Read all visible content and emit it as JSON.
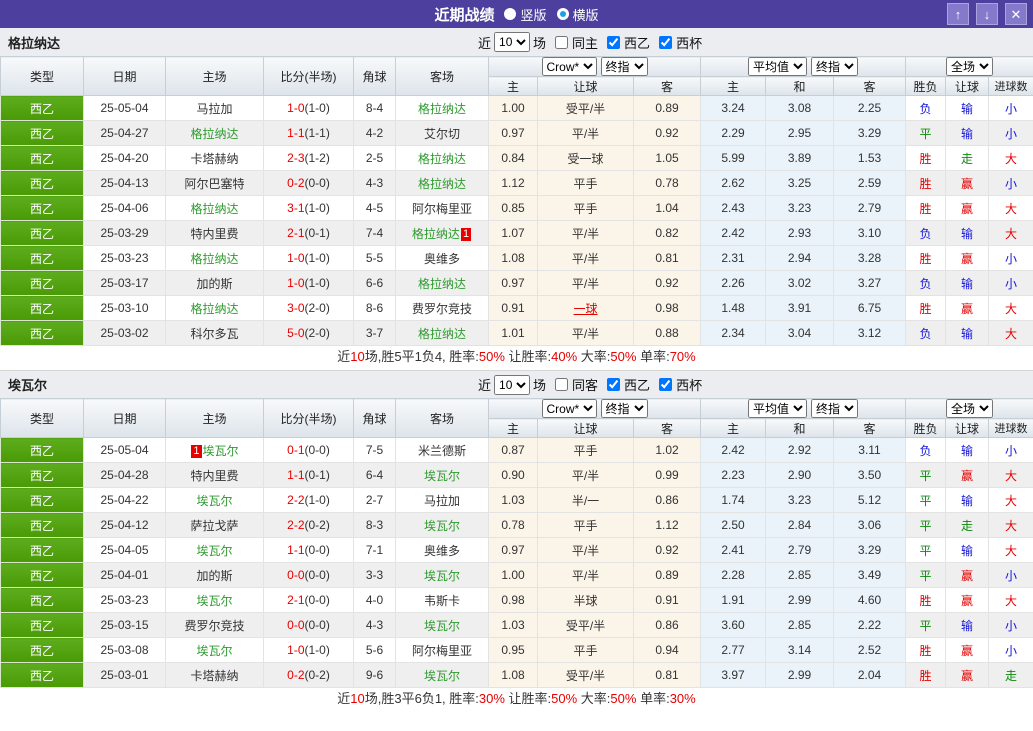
{
  "titlebar": {
    "title": "近期战绩",
    "radios": [
      {
        "label": "竖版",
        "selected": false
      },
      {
        "label": "横版",
        "selected": true
      }
    ],
    "buttons": {
      "up": "↑",
      "down": "↓",
      "close": "✕"
    }
  },
  "colors": {
    "titlebar_bg": "#4c3f9d",
    "titlebar_button_bg": "#837acb",
    "league_cell_green": "#4a9a06",
    "team_highlight_green": "#2e9b2e",
    "score_red": "#e60000",
    "win_red": "#e60000",
    "draw_green": "#0b8a0b",
    "lose_blue": "#1414d8",
    "crow_col_bg": "#fbf4e8",
    "avg_col_bg": "#e9f3f9"
  },
  "table_header": {
    "cols": [
      "类型",
      "日期",
      "主场",
      "比分(半场)",
      "角球",
      "客场"
    ],
    "sub": [
      "主",
      "让球",
      "客",
      "主",
      "和",
      "客",
      "胜负",
      "让球",
      "进球数"
    ],
    "selects": {
      "company": "Crow*",
      "final1": "终指",
      "average": "平均值",
      "final2": "终指",
      "scope": "全场"
    }
  },
  "sections": [
    {
      "team": "格拉纳达",
      "filter": {
        "prefix": "近",
        "count": "10",
        "suffix": "场",
        "same_label": "同主",
        "same_checked": false,
        "league_label": "西乙",
        "league_checked": true,
        "cup_label": "西杯",
        "cup_checked": true
      },
      "rows": [
        {
          "league": "西乙",
          "date": "25-05-04",
          "home": "马拉加",
          "home_hl": false,
          "home_badge": "",
          "home_badge_pos": "",
          "score": "1-0",
          "half": "(1-0)",
          "corner": "8-4",
          "away": "格拉纳达",
          "away_hl": true,
          "away_badge": "",
          "away_badge_pos": "",
          "crow_h": "1.00",
          "line": "受平/半",
          "line_changed": false,
          "crow_a": "0.89",
          "avg_h": "3.24",
          "avg_d": "3.08",
          "avg_a": "2.25",
          "result": "负",
          "asian": "输",
          "goals": "小"
        },
        {
          "league": "西乙",
          "date": "25-04-27",
          "home": "格拉纳达",
          "home_hl": true,
          "home_badge": "",
          "home_badge_pos": "",
          "score": "1-1",
          "half": "(1-1)",
          "corner": "4-2",
          "away": "艾尔切",
          "away_hl": false,
          "away_badge": "",
          "away_badge_pos": "",
          "crow_h": "0.97",
          "line": "平/半",
          "line_changed": false,
          "crow_a": "0.92",
          "avg_h": "2.29",
          "avg_d": "2.95",
          "avg_a": "3.29",
          "result": "平",
          "asian": "输",
          "goals": "小"
        },
        {
          "league": "西乙",
          "date": "25-04-20",
          "home": "卡塔赫纳",
          "home_hl": false,
          "home_badge": "",
          "home_badge_pos": "",
          "score": "2-3",
          "half": "(1-2)",
          "corner": "2-5",
          "away": "格拉纳达",
          "away_hl": true,
          "away_badge": "",
          "away_badge_pos": "",
          "crow_h": "0.84",
          "line": "受一球",
          "line_changed": false,
          "crow_a": "1.05",
          "avg_h": "5.99",
          "avg_d": "3.89",
          "avg_a": "1.53",
          "result": "胜",
          "asian": "走",
          "goals": "大"
        },
        {
          "league": "西乙",
          "date": "25-04-13",
          "home": "阿尔巴塞特",
          "home_hl": false,
          "home_badge": "",
          "home_badge_pos": "",
          "score": "0-2",
          "half": "(0-0)",
          "corner": "4-3",
          "away": "格拉纳达",
          "away_hl": true,
          "away_badge": "",
          "away_badge_pos": "",
          "crow_h": "1.12",
          "line": "平手",
          "line_changed": false,
          "crow_a": "0.78",
          "avg_h": "2.62",
          "avg_d": "3.25",
          "avg_a": "2.59",
          "result": "胜",
          "asian": "赢",
          "goals": "小"
        },
        {
          "league": "西乙",
          "date": "25-04-06",
          "home": "格拉纳达",
          "home_hl": true,
          "home_badge": "",
          "home_badge_pos": "",
          "score": "3-1",
          "half": "(1-0)",
          "corner": "4-5",
          "away": "阿尔梅里亚",
          "away_hl": false,
          "away_badge": "",
          "away_badge_pos": "",
          "crow_h": "0.85",
          "line": "平手",
          "line_changed": false,
          "crow_a": "1.04",
          "avg_h": "2.43",
          "avg_d": "3.23",
          "avg_a": "2.79",
          "result": "胜",
          "asian": "赢",
          "goals": "大"
        },
        {
          "league": "西乙",
          "date": "25-03-29",
          "home": "特内里费",
          "home_hl": false,
          "home_badge": "",
          "home_badge_pos": "",
          "score": "2-1",
          "half": "(0-1)",
          "corner": "7-4",
          "away": "格拉纳达",
          "away_hl": true,
          "away_badge": "1",
          "away_badge_pos": "after",
          "crow_h": "1.07",
          "line": "平/半",
          "line_changed": false,
          "crow_a": "0.82",
          "avg_h": "2.42",
          "avg_d": "2.93",
          "avg_a": "3.10",
          "result": "负",
          "asian": "输",
          "goals": "大"
        },
        {
          "league": "西乙",
          "date": "25-03-23",
          "home": "格拉纳达",
          "home_hl": true,
          "home_badge": "",
          "home_badge_pos": "",
          "score": "1-0",
          "half": "(1-0)",
          "corner": "5-5",
          "away": "奥维多",
          "away_hl": false,
          "away_badge": "",
          "away_badge_pos": "",
          "crow_h": "1.08",
          "line": "平/半",
          "line_changed": false,
          "crow_a": "0.81",
          "avg_h": "2.31",
          "avg_d": "2.94",
          "avg_a": "3.28",
          "result": "胜",
          "asian": "赢",
          "goals": "小"
        },
        {
          "league": "西乙",
          "date": "25-03-17",
          "home": "加的斯",
          "home_hl": false,
          "home_badge": "",
          "home_badge_pos": "",
          "score": "1-0",
          "half": "(1-0)",
          "corner": "6-6",
          "away": "格拉纳达",
          "away_hl": true,
          "away_badge": "",
          "away_badge_pos": "",
          "crow_h": "0.97",
          "line": "平/半",
          "line_changed": false,
          "crow_a": "0.92",
          "avg_h": "2.26",
          "avg_d": "3.02",
          "avg_a": "3.27",
          "result": "负",
          "asian": "输",
          "goals": "小"
        },
        {
          "league": "西乙",
          "date": "25-03-10",
          "home": "格拉纳达",
          "home_hl": true,
          "home_badge": "",
          "home_badge_pos": "",
          "score": "3-0",
          "half": "(2-0)",
          "corner": "8-6",
          "away": "费罗尔竞技",
          "away_hl": false,
          "away_badge": "",
          "away_badge_pos": "",
          "crow_h": "0.91",
          "line": "一球",
          "line_changed": true,
          "crow_a": "0.98",
          "avg_h": "1.48",
          "avg_d": "3.91",
          "avg_a": "6.75",
          "result": "胜",
          "asian": "赢",
          "goals": "大"
        },
        {
          "league": "西乙",
          "date": "25-03-02",
          "home": "科尔多瓦",
          "home_hl": false,
          "home_badge": "",
          "home_badge_pos": "",
          "score": "5-0",
          "half": "(2-0)",
          "corner": "3-7",
          "away": "格拉纳达",
          "away_hl": true,
          "away_badge": "",
          "away_badge_pos": "",
          "crow_h": "1.01",
          "line": "平/半",
          "line_changed": false,
          "crow_a": "0.88",
          "avg_h": "2.34",
          "avg_d": "3.04",
          "avg_a": "3.12",
          "result": "负",
          "asian": "输",
          "goals": "大"
        }
      ],
      "summary": [
        {
          "t": "近",
          "red": false
        },
        {
          "t": "10",
          "red": true
        },
        {
          "t": "场,胜5平1负4, 胜率:",
          "red": false
        },
        {
          "t": "50%",
          "red": true
        },
        {
          "t": " 让胜率:",
          "red": false
        },
        {
          "t": "40%",
          "red": true
        },
        {
          "t": " 大率:",
          "red": false
        },
        {
          "t": "50%",
          "red": true
        },
        {
          "t": " 单率:",
          "red": false
        },
        {
          "t": "70%",
          "red": true
        }
      ]
    },
    {
      "team": "埃瓦尔",
      "filter": {
        "prefix": "近",
        "count": "10",
        "suffix": "场",
        "same_label": "同客",
        "same_checked": false,
        "league_label": "西乙",
        "league_checked": true,
        "cup_label": "西杯",
        "cup_checked": true
      },
      "rows": [
        {
          "league": "西乙",
          "date": "25-05-04",
          "home": "埃瓦尔",
          "home_hl": true,
          "home_badge": "1",
          "home_badge_pos": "before",
          "score": "0-1",
          "half": "(0-0)",
          "corner": "7-5",
          "away": "米兰德斯",
          "away_hl": false,
          "away_badge": "",
          "away_badge_pos": "",
          "crow_h": "0.87",
          "line": "平手",
          "line_changed": false,
          "crow_a": "1.02",
          "avg_h": "2.42",
          "avg_d": "2.92",
          "avg_a": "3.11",
          "result": "负",
          "asian": "输",
          "goals": "小"
        },
        {
          "league": "西乙",
          "date": "25-04-28",
          "home": "特内里费",
          "home_hl": false,
          "home_badge": "",
          "home_badge_pos": "",
          "score": "1-1",
          "half": "(0-1)",
          "corner": "6-4",
          "away": "埃瓦尔",
          "away_hl": true,
          "away_badge": "",
          "away_badge_pos": "",
          "crow_h": "0.90",
          "line": "平/半",
          "line_changed": false,
          "crow_a": "0.99",
          "avg_h": "2.23",
          "avg_d": "2.90",
          "avg_a": "3.50",
          "result": "平",
          "asian": "赢",
          "goals": "大"
        },
        {
          "league": "西乙",
          "date": "25-04-22",
          "home": "埃瓦尔",
          "home_hl": true,
          "home_badge": "",
          "home_badge_pos": "",
          "score": "2-2",
          "half": "(1-0)",
          "corner": "2-7",
          "away": "马拉加",
          "away_hl": false,
          "away_badge": "",
          "away_badge_pos": "",
          "crow_h": "1.03",
          "line": "半/一",
          "line_changed": false,
          "crow_a": "0.86",
          "avg_h": "1.74",
          "avg_d": "3.23",
          "avg_a": "5.12",
          "result": "平",
          "asian": "输",
          "goals": "大"
        },
        {
          "league": "西乙",
          "date": "25-04-12",
          "home": "萨拉戈萨",
          "home_hl": false,
          "home_badge": "",
          "home_badge_pos": "",
          "score": "2-2",
          "half": "(0-2)",
          "corner": "8-3",
          "away": "埃瓦尔",
          "away_hl": true,
          "away_badge": "",
          "away_badge_pos": "",
          "crow_h": "0.78",
          "line": "平手",
          "line_changed": false,
          "crow_a": "1.12",
          "avg_h": "2.50",
          "avg_d": "2.84",
          "avg_a": "3.06",
          "result": "平",
          "asian": "走",
          "goals": "大"
        },
        {
          "league": "西乙",
          "date": "25-04-05",
          "home": "埃瓦尔",
          "home_hl": true,
          "home_badge": "",
          "home_badge_pos": "",
          "score": "1-1",
          "half": "(0-0)",
          "corner": "7-1",
          "away": "奥维多",
          "away_hl": false,
          "away_badge": "",
          "away_badge_pos": "",
          "crow_h": "0.97",
          "line": "平/半",
          "line_changed": false,
          "crow_a": "0.92",
          "avg_h": "2.41",
          "avg_d": "2.79",
          "avg_a": "3.29",
          "result": "平",
          "asian": "输",
          "goals": "大"
        },
        {
          "league": "西乙",
          "date": "25-04-01",
          "home": "加的斯",
          "home_hl": false,
          "home_badge": "",
          "home_badge_pos": "",
          "score": "0-0",
          "half": "(0-0)",
          "corner": "3-3",
          "away": "埃瓦尔",
          "away_hl": true,
          "away_badge": "",
          "away_badge_pos": "",
          "crow_h": "1.00",
          "line": "平/半",
          "line_changed": false,
          "crow_a": "0.89",
          "avg_h": "2.28",
          "avg_d": "2.85",
          "avg_a": "3.49",
          "result": "平",
          "asian": "赢",
          "goals": "小"
        },
        {
          "league": "西乙",
          "date": "25-03-23",
          "home": "埃瓦尔",
          "home_hl": true,
          "home_badge": "",
          "home_badge_pos": "",
          "score": "2-1",
          "half": "(0-0)",
          "corner": "4-0",
          "away": "韦斯卡",
          "away_hl": false,
          "away_badge": "",
          "away_badge_pos": "",
          "crow_h": "0.98",
          "line": "半球",
          "line_changed": false,
          "crow_a": "0.91",
          "avg_h": "1.91",
          "avg_d": "2.99",
          "avg_a": "4.60",
          "result": "胜",
          "asian": "赢",
          "goals": "大"
        },
        {
          "league": "西乙",
          "date": "25-03-15",
          "home": "费罗尔竞技",
          "home_hl": false,
          "home_badge": "",
          "home_badge_pos": "",
          "score": "0-0",
          "half": "(0-0)",
          "corner": "4-3",
          "away": "埃瓦尔",
          "away_hl": true,
          "away_badge": "",
          "away_badge_pos": "",
          "crow_h": "1.03",
          "line": "受平/半",
          "line_changed": false,
          "crow_a": "0.86",
          "avg_h": "3.60",
          "avg_d": "2.85",
          "avg_a": "2.22",
          "result": "平",
          "asian": "输",
          "goals": "小"
        },
        {
          "league": "西乙",
          "date": "25-03-08",
          "home": "埃瓦尔",
          "home_hl": true,
          "home_badge": "",
          "home_badge_pos": "",
          "score": "1-0",
          "half": "(1-0)",
          "corner": "5-6",
          "away": "阿尔梅里亚",
          "away_hl": false,
          "away_badge": "",
          "away_badge_pos": "",
          "crow_h": "0.95",
          "line": "平手",
          "line_changed": false,
          "crow_a": "0.94",
          "avg_h": "2.77",
          "avg_d": "3.14",
          "avg_a": "2.52",
          "result": "胜",
          "asian": "赢",
          "goals": "小"
        },
        {
          "league": "西乙",
          "date": "25-03-01",
          "home": "卡塔赫纳",
          "home_hl": false,
          "home_badge": "",
          "home_badge_pos": "",
          "score": "0-2",
          "half": "(0-2)",
          "corner": "9-6",
          "away": "埃瓦尔",
          "away_hl": true,
          "away_badge": "",
          "away_badge_pos": "",
          "crow_h": "1.08",
          "line": "受平/半",
          "line_changed": false,
          "crow_a": "0.81",
          "avg_h": "3.97",
          "avg_d": "2.99",
          "avg_a": "2.04",
          "result": "胜",
          "asian": "赢",
          "goals": "走"
        }
      ],
      "summary": [
        {
          "t": "近",
          "red": false
        },
        {
          "t": "10",
          "red": true
        },
        {
          "t": "场,胜3平6负1, 胜率:",
          "red": false
        },
        {
          "t": "30%",
          "red": true
        },
        {
          "t": " 让胜率:",
          "red": false
        },
        {
          "t": "50%",
          "red": true
        },
        {
          "t": " 大率:",
          "red": false
        },
        {
          "t": "50%",
          "red": true
        },
        {
          "t": " 单率:",
          "red": false
        },
        {
          "t": "30%",
          "red": true
        }
      ]
    }
  ]
}
